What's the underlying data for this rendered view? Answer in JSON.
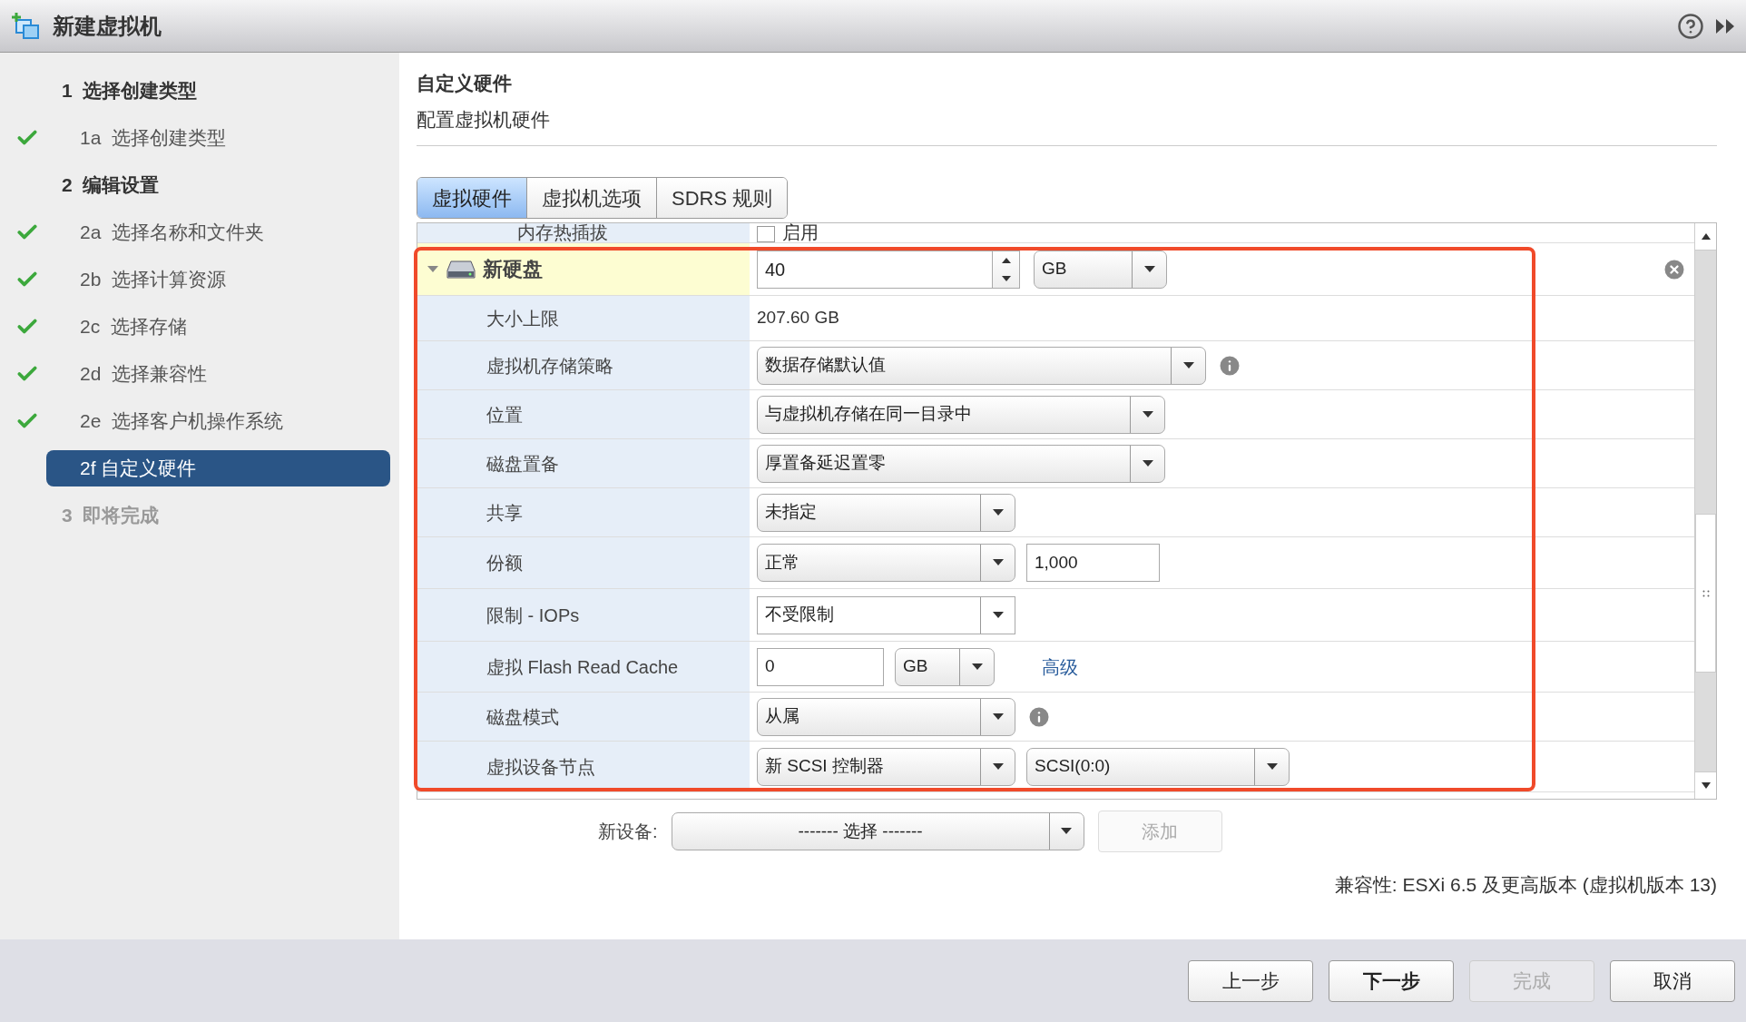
{
  "window": {
    "title": "新建虚拟机"
  },
  "steps": [
    {
      "kind": "heading",
      "number": "1",
      "label": "选择创建类型",
      "disabled": false
    },
    {
      "kind": "step",
      "number": "1a",
      "label": "选择创建类型",
      "done": true,
      "selected": false
    },
    {
      "kind": "heading",
      "number": "2",
      "label": "编辑设置",
      "disabled": false
    },
    {
      "kind": "step",
      "number": "2a",
      "label": "选择名称和文件夹",
      "done": true,
      "selected": false
    },
    {
      "kind": "step",
      "number": "2b",
      "label": "选择计算资源",
      "done": true,
      "selected": false
    },
    {
      "kind": "step",
      "number": "2c",
      "label": "选择存储",
      "done": true,
      "selected": false
    },
    {
      "kind": "step",
      "number": "2d",
      "label": "选择兼容性",
      "done": true,
      "selected": false
    },
    {
      "kind": "step",
      "number": "2e",
      "label": "选择客户机操作系统",
      "done": true,
      "selected": false
    },
    {
      "kind": "step",
      "number": "2f",
      "label": "自定义硬件",
      "done": false,
      "selected": true
    },
    {
      "kind": "heading",
      "number": "3",
      "label": "即将完成",
      "disabled": true
    }
  ],
  "page": {
    "title": "自定义硬件",
    "subtitle": "配置虚拟机硬件"
  },
  "tabs": [
    {
      "label": "虚拟硬件",
      "selected": true
    },
    {
      "label": "虚拟机选项",
      "selected": false
    },
    {
      "label": "SDRS 规则",
      "selected": false
    }
  ],
  "memory_row": {
    "label": "内存热插拔",
    "option": "启用",
    "checked": false
  },
  "disk": {
    "name": "新硬盘",
    "expanded": true,
    "highlighted": true,
    "size": "40",
    "unit": "GB",
    "rows": [
      {
        "label": "大小上限",
        "controls": [
          {
            "kind": "text",
            "value": "207.60 GB"
          }
        ]
      },
      {
        "label": "虚拟机存储策略",
        "controls": [
          {
            "kind": "select",
            "value": "数据存储默认值"
          },
          {
            "kind": "info"
          }
        ]
      },
      {
        "label": "位置",
        "controls": [
          {
            "kind": "select",
            "value": "与虚拟机存储在同一目录中"
          }
        ]
      },
      {
        "label": "磁盘置备",
        "controls": [
          {
            "kind": "select",
            "value": "厚置备延迟置零"
          }
        ]
      },
      {
        "label": "共享",
        "controls": [
          {
            "kind": "select",
            "value": "未指定"
          }
        ]
      },
      {
        "label": "份额",
        "controls": [
          {
            "kind": "select",
            "value": "正常"
          },
          {
            "kind": "field",
            "value": "1,000"
          }
        ]
      },
      {
        "label": "限制 - IOPs",
        "controls": [
          {
            "kind": "combo",
            "value": "不受限制"
          }
        ]
      },
      {
        "label": "虚拟 Flash Read Cache",
        "controls": [
          {
            "kind": "field",
            "value": "0"
          },
          {
            "kind": "select",
            "value": "GB"
          },
          {
            "kind": "link",
            "value": "高级"
          }
        ]
      },
      {
        "label": "磁盘模式",
        "controls": [
          {
            "kind": "select",
            "value": "从属"
          },
          {
            "kind": "info"
          }
        ]
      },
      {
        "label": "虚拟设备节点",
        "controls": [
          {
            "kind": "select",
            "value": "新 SCSI 控制器"
          },
          {
            "kind": "select",
            "value": "SCSI(0:0)"
          }
        ]
      }
    ]
  },
  "new_device": {
    "label": "新设备:",
    "value": "------- 选择 -------",
    "add_button": {
      "label": "添加",
      "disabled": true
    }
  },
  "compatibility": "兼容性: ESXi 6.5 及更高版本 (虚拟机版本 13)",
  "buttons": [
    {
      "label": "上一步",
      "disabled": false,
      "primary": false
    },
    {
      "label": "下一步",
      "disabled": false,
      "primary": true
    },
    {
      "label": "完成",
      "disabled": true,
      "primary": false
    },
    {
      "label": "取消",
      "disabled": false,
      "primary": false
    }
  ]
}
